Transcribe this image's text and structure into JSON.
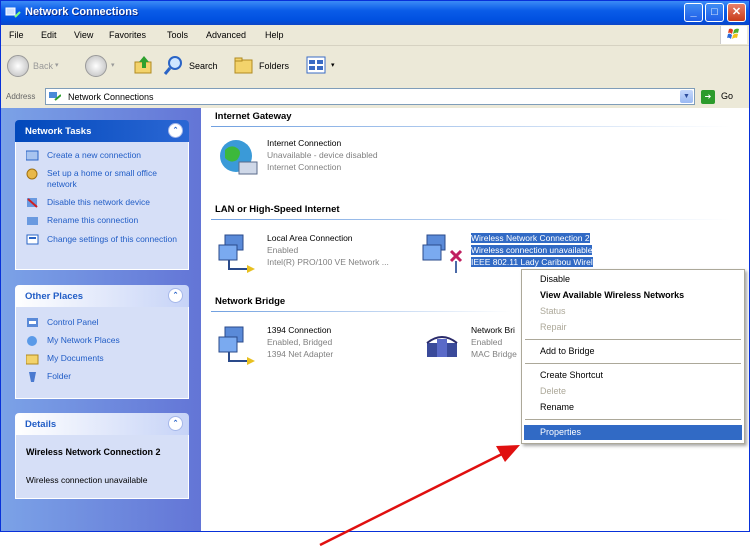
{
  "window": {
    "title": "Network Connections"
  },
  "menubar": {
    "items": [
      "File",
      "Edit",
      "View",
      "Favorites",
      "Tools",
      "Advanced",
      "Help"
    ]
  },
  "toolbar": {
    "back": "Back",
    "search": "Search",
    "folders": "Folders"
  },
  "address": {
    "label": "Address",
    "value": "Network Connections",
    "go": "Go"
  },
  "network_tasks": {
    "title": "Network Tasks",
    "items": [
      {
        "label": "Create a new connection",
        "icon": "new-connection-icon"
      },
      {
        "label": "Set up a home or small office network",
        "icon": "home-network-icon"
      },
      {
        "label": "Disable this network device",
        "icon": "disable-device-icon"
      },
      {
        "label": "Rename this connection",
        "icon": "rename-icon"
      },
      {
        "label": "Change settings of this connection",
        "icon": "settings-icon"
      }
    ]
  },
  "other_places": {
    "title": "Other Places",
    "items": [
      {
        "label": "Control Panel",
        "icon": "control-panel-icon"
      },
      {
        "label": "My Network Places",
        "icon": "network-places-icon"
      },
      {
        "label": "My Documents",
        "icon": "documents-folder-icon"
      },
      {
        "label": "Folder",
        "icon": "folder-icon"
      }
    ]
  },
  "details": {
    "title": "Details",
    "name": "Wireless Network Connection 2",
    "status": "Wireless connection unavailable"
  },
  "groups": {
    "gateway": {
      "title": "Internet Gateway",
      "connection": {
        "name": "Internet Connection",
        "status": "Unavailable - device disabled",
        "device": "Internet Connection"
      }
    },
    "lan": {
      "title": "LAN or High-Speed Internet",
      "local": {
        "name": "Local Area Connection",
        "status": "Enabled",
        "device": "Intel(R) PRO/100 VE Network ..."
      },
      "wireless": {
        "name": "Wireless Network Connection 2",
        "status": "Wireless connection unavailable",
        "device": "IEEE 802.11 Lady Caribou Wirel"
      }
    },
    "bridge": {
      "title": "Network Bridge",
      "c1394": {
        "name": "1394 Connection",
        "status": "Enabled, Bridged",
        "device": "1394 Net Adapter"
      },
      "bridge": {
        "name": "Network Bri",
        "status": "Enabled",
        "device": "MAC Bridge"
      }
    }
  },
  "context_menu": {
    "items": [
      "Disable",
      "View Available Wireless Networks",
      "Status",
      "Repair",
      "Add to Bridge",
      "Create Shortcut",
      "Delete",
      "Rename",
      "Properties"
    ]
  },
  "colors": {
    "title_blue": "#0a5ce8",
    "selection": "#316ac5",
    "annotation_arrow": "#e01010"
  }
}
